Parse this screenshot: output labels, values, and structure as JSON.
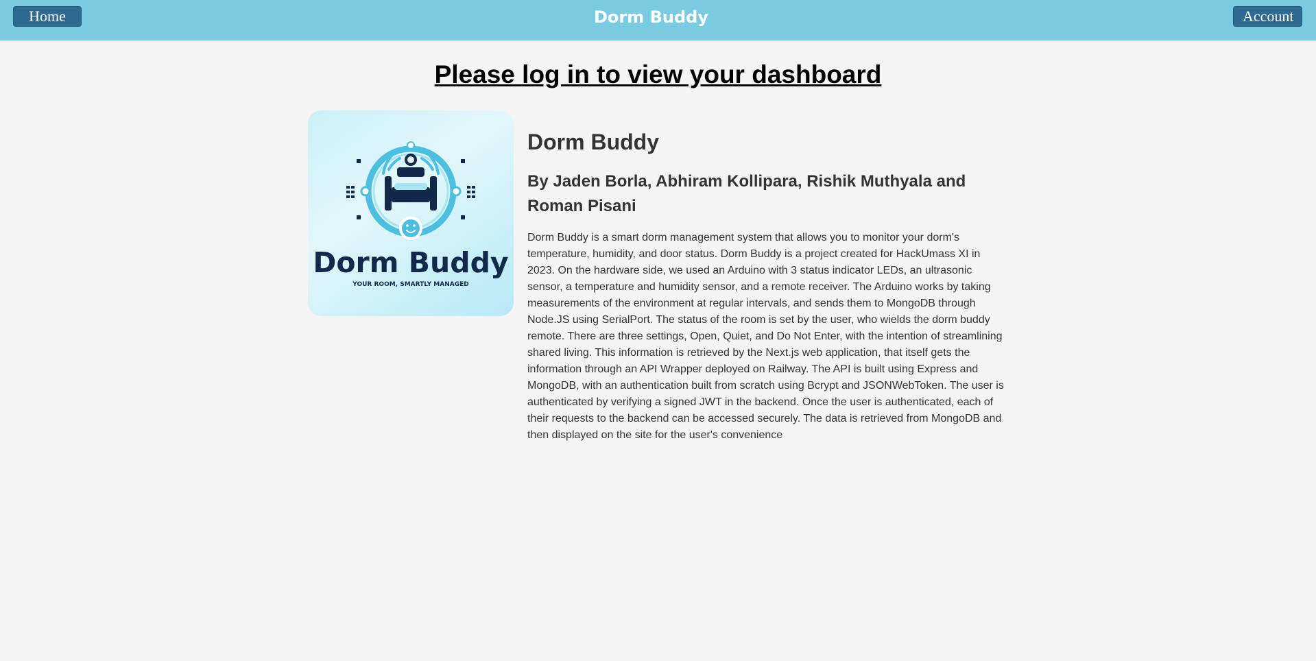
{
  "nav": {
    "home_label": "Home",
    "brand": "Dorm Buddy",
    "account_label": "Account"
  },
  "main": {
    "login_prompt": "Please log in to view your dashboard",
    "logo": {
      "wordmark": "Dorm Buddy",
      "tagline": "YOUR ROOM, SMARTLY MANAGED"
    },
    "title": "Dorm Buddy",
    "authors": "By Jaden Borla, Abhiram Kollipara, Rishik Muthyala and Roman Pisani",
    "description": "Dorm Buddy is a smart dorm management system that allows you to monitor your dorm's temperature, humidity, and door status. Dorm Buddy is a project created for HackUmass XI in 2023. On the hardware side, we used an Arduino with 3 status indicator LEDs, an ultrasonic sensor, a temperature and humidity sensor, and a remote receiver. The Arduino works by taking measurements of the environment at regular intervals, and sends them to MongoDB through Node.JS using SerialPort. The status of the room is set by the user, who wields the dorm buddy remote. There are three settings, Open, Quiet, and Do Not Enter, with the intention of streamlining shared living. This information is retrieved by the Next.js web application, that itself gets the information through an API Wrapper deployed on Railway. The API is built using Express and MongoDB, with an authentication built from scratch using Bcrypt and JSONWebToken. The user is authenticated by verifying a signed JWT in the backend. Once the user is authenticated, each of their requests to the backend can be accessed securely. The data is retrieved from MongoDB and then displayed on the site for the user's convenience"
  },
  "colors": {
    "topbar": "#78cbe0",
    "nav_button": "#2f6a93",
    "page_background": "#f4f4f4",
    "logo_navy": "#13294b",
    "logo_cyan": "#4cbfe0"
  },
  "icons": {
    "logo_emblem": "bed-icon",
    "logo_face": "smiley-icon",
    "logo_signal": "wifi-signal-icon"
  }
}
